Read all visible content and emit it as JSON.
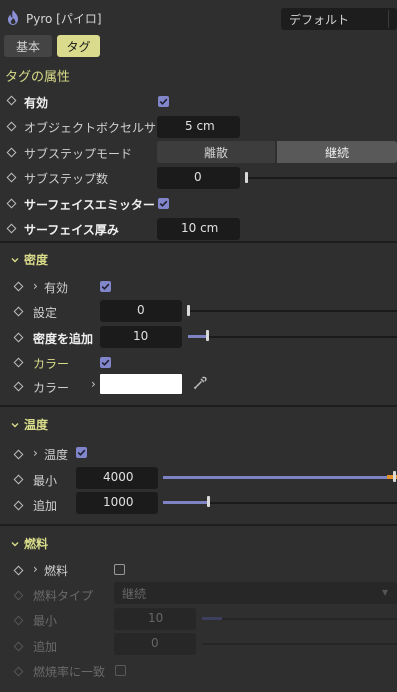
{
  "header": {
    "title": "Pyro [パイロ]",
    "preset": "デフォルト"
  },
  "tabs": [
    {
      "label": "基本",
      "active": false
    },
    {
      "label": "タグ",
      "active": true
    }
  ],
  "tag_section": {
    "title": "タグの属性",
    "enabled_label": "有効",
    "voxel_label": "オブジェクトボクセルサイズ",
    "voxel_value": "5 cm",
    "substep_mode_label": "サブステップモード",
    "substep_mode_options": [
      "離散",
      "継続"
    ],
    "substep_mode_selected": "継続",
    "substep_count_label": "サブステップ数",
    "substep_count_value": "0",
    "emitter_label": "サーフェイスエミッター",
    "thickness_label": "サーフェイス厚み",
    "thickness_value": "10 cm"
  },
  "density": {
    "title": "密度",
    "enabled_label": "有効",
    "setting_label": "設定",
    "setting_value": "0",
    "add_label": "密度を追加",
    "add_value": "10",
    "add_fraction": 0.1,
    "color_toggle_label": "カラー",
    "color_label": "カラー",
    "color_value": "#ffffff"
  },
  "temperature": {
    "title": "温度",
    "enabled_label": "温度",
    "min_label": "最小",
    "min_value": "4000",
    "min_fraction": 1.0,
    "add_label": "追加",
    "add_value": "1000",
    "add_fraction": 0.2
  },
  "fuel": {
    "title": "燃料",
    "enabled_label": "燃料",
    "type_label": "燃料タイプ",
    "type_value": "継続",
    "min_label": "最小",
    "min_value": "10",
    "add_label": "追加",
    "add_value": "0",
    "burn_label": "燃焼率に一致"
  },
  "colors": {
    "accent": "#d9dc8a",
    "checkbox": "#8185c9",
    "slider_fill": "#7e83c4",
    "panel_bg": "#2f2f2f",
    "field_bg": "#1b1b1b"
  }
}
